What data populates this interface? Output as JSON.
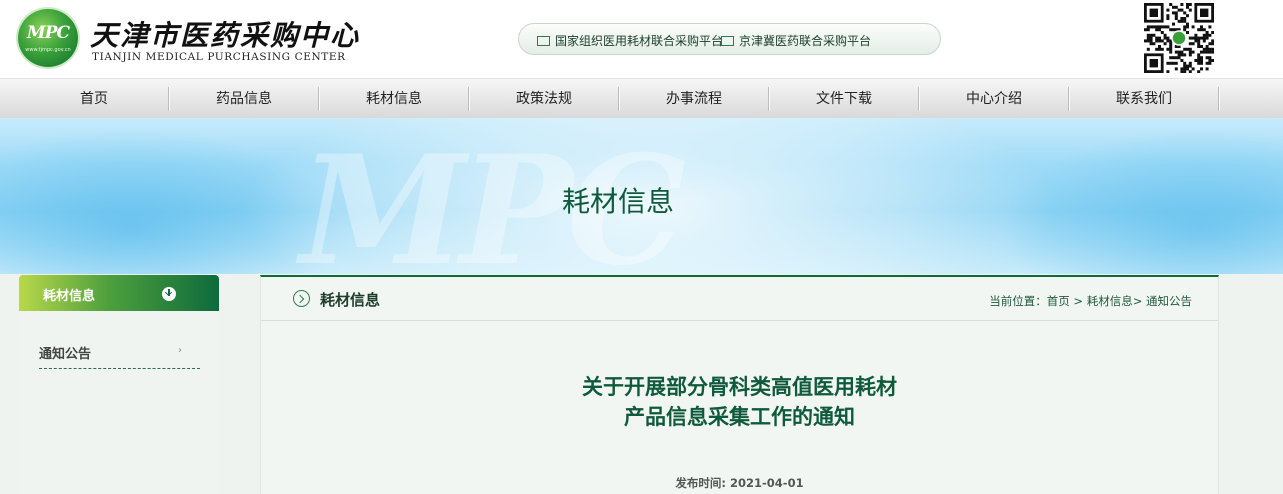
{
  "header": {
    "logo_mark": "MPC",
    "logo_url": "www.tjmpc.gov.cn",
    "site_title": "天津市医药采购中心",
    "site_subtitle": "TIANJIN MEDICAL PURCHASING CENTER",
    "platform_links": [
      {
        "label": "国家组织医用耗材联合采购平台"
      },
      {
        "label": "京津冀医药联合采购平台"
      }
    ],
    "qr_icon": "qr-code-icon"
  },
  "nav": {
    "items": [
      {
        "label": "首页"
      },
      {
        "label": "药品信息"
      },
      {
        "label": "耗材信息"
      },
      {
        "label": "政策法规"
      },
      {
        "label": "办事流程"
      },
      {
        "label": "文件下载"
      },
      {
        "label": "中心介绍"
      },
      {
        "label": "联系我们"
      }
    ]
  },
  "banner": {
    "watermark": "MPC",
    "title": "耗材信息"
  },
  "sidebar": {
    "header": "耗材信息",
    "items": [
      {
        "label": "通知公告"
      }
    ]
  },
  "main": {
    "section_title": "耗材信息",
    "breadcrumb": "当前位置：首页 > 耗材信息> 通知公告",
    "article": {
      "title_line1": "关于开展部分骨科类高值医用耗材",
      "title_line2": "产品信息采集工作的通知",
      "publish_time": "发布时间: 2021-04-01"
    }
  },
  "colors": {
    "brand_green": "#0d6b3c",
    "title_green": "#0f5a3a",
    "banner_blue": "#8fd4f4"
  }
}
